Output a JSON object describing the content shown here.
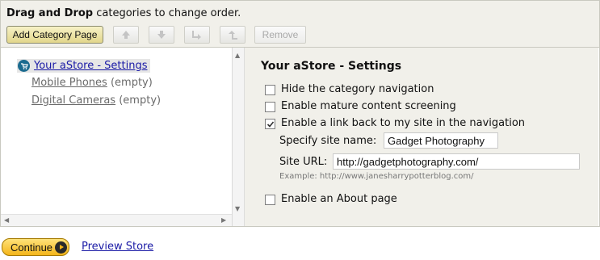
{
  "header": {
    "instruction_bold": "Drag and Drop",
    "instruction_rest": " categories to change order.",
    "add_button": "Add Category Page",
    "toolbar_icons": [
      "move-up-icon",
      "move-down-icon",
      "indent-icon",
      "outdent-icon"
    ],
    "remove_button": "Remove"
  },
  "tree": {
    "items": [
      {
        "label": "Your aStore - Settings",
        "suffix": ""
      },
      {
        "label": "Mobile Phones",
        "suffix": "(empty)"
      },
      {
        "label": "Digital Cameras",
        "suffix": "(empty)"
      }
    ]
  },
  "settings": {
    "title": "Your aStore - Settings",
    "options": [
      {
        "label": "Hide the category navigation",
        "checked": false
      },
      {
        "label": "Enable mature content screening",
        "checked": false
      },
      {
        "label": "Enable a link back to my site in the navigation",
        "checked": true
      },
      {
        "label": "Enable an About page",
        "checked": false
      }
    ],
    "site_name_label": "Specify site name:",
    "site_name_value": "Gadget Photography",
    "site_url_label": "Site URL:",
    "site_url_value": "http://gadgetphotography.com/",
    "example": "Example: http://www.janesharrypotterblog.com/"
  },
  "footer": {
    "continue_button": "Continue",
    "preview_link": "Preview Store"
  },
  "colors": {
    "accent_link": "#1a1aa6",
    "panel_bg": "#f1f0ea",
    "continue_gold": "#f4b51a"
  }
}
